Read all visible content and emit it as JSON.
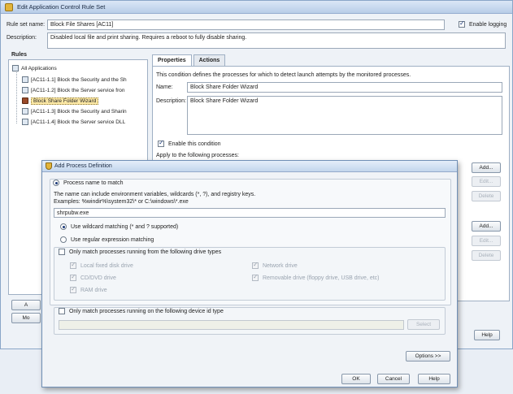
{
  "main_window": {
    "title": "Edit Application Control Rule Set",
    "rule_set_name_label": "Rule set name:",
    "rule_set_name_value": "Block File Shares [AC11]",
    "enable_logging_label": "Enable logging",
    "description_label": "Description:",
    "description_value": "Disabled local file and print sharing.  Requires a reboot to fully disable sharing.",
    "rules_header": "Rules",
    "tree": {
      "root": "All Applications",
      "items": [
        {
          "label": "[AC11-1.1] Block the Security and the Sh"
        },
        {
          "label": "[AC11-1.2] Block the Server service fron"
        },
        {
          "label": "Block Share Folder Wizard"
        },
        {
          "label": "[AC11-1.3] Block the Security and Sharin"
        },
        {
          "label": "[AC11-1.4] Block the Server service DLL"
        }
      ]
    },
    "tabs": [
      {
        "label": "Properties"
      },
      {
        "label": "Actions"
      }
    ],
    "properties": {
      "intro": "This condition defines the processes for which to detect launch attempts by the monitored processes.",
      "name_label": "Name:",
      "name_value": "Block Share Folder Wizard",
      "description_label": "Description:",
      "description_value": "Block Share Folder Wizard",
      "enable_condition_label": "Enable this condition",
      "apply_label": "Apply to the following processes:"
    },
    "side_buttons": {
      "add": "Add...",
      "edit": "Edit...",
      "delete": "Delete"
    },
    "left_buttons": {
      "a": "A",
      "m": "Mo"
    },
    "help": "Help"
  },
  "dialog": {
    "title": "Add Process Definition",
    "process_name_match_label": "Process name to match",
    "hint_line1": "The name can include environment variables, wildcards (*, ?), and registry keys.",
    "hint_line2": "Examples: %windir%\\system32\\* or C:\\windows\\*.exe",
    "process_name_value": "shrpubw.exe",
    "use_wildcard_label": "Use wildcard matching (* and ? supported)",
    "use_regex_label": "Use regular expression matching",
    "drive_types_label": "Only match processes running from the following drive types",
    "drive_types": {
      "local_fixed": "Local fixed disk drive",
      "cd_dvd": "CD/DVD drive",
      "ram": "RAM drive",
      "network": "Network drive",
      "removable": "Removable drive (floppy drive, USB drive, etc)"
    },
    "device_id_label": "Only match processes running on the following device id type",
    "select_button": "Select",
    "options_button": "Options >>",
    "ok_button": "OK",
    "cancel_button": "Cancel",
    "help_button": "Help"
  }
}
